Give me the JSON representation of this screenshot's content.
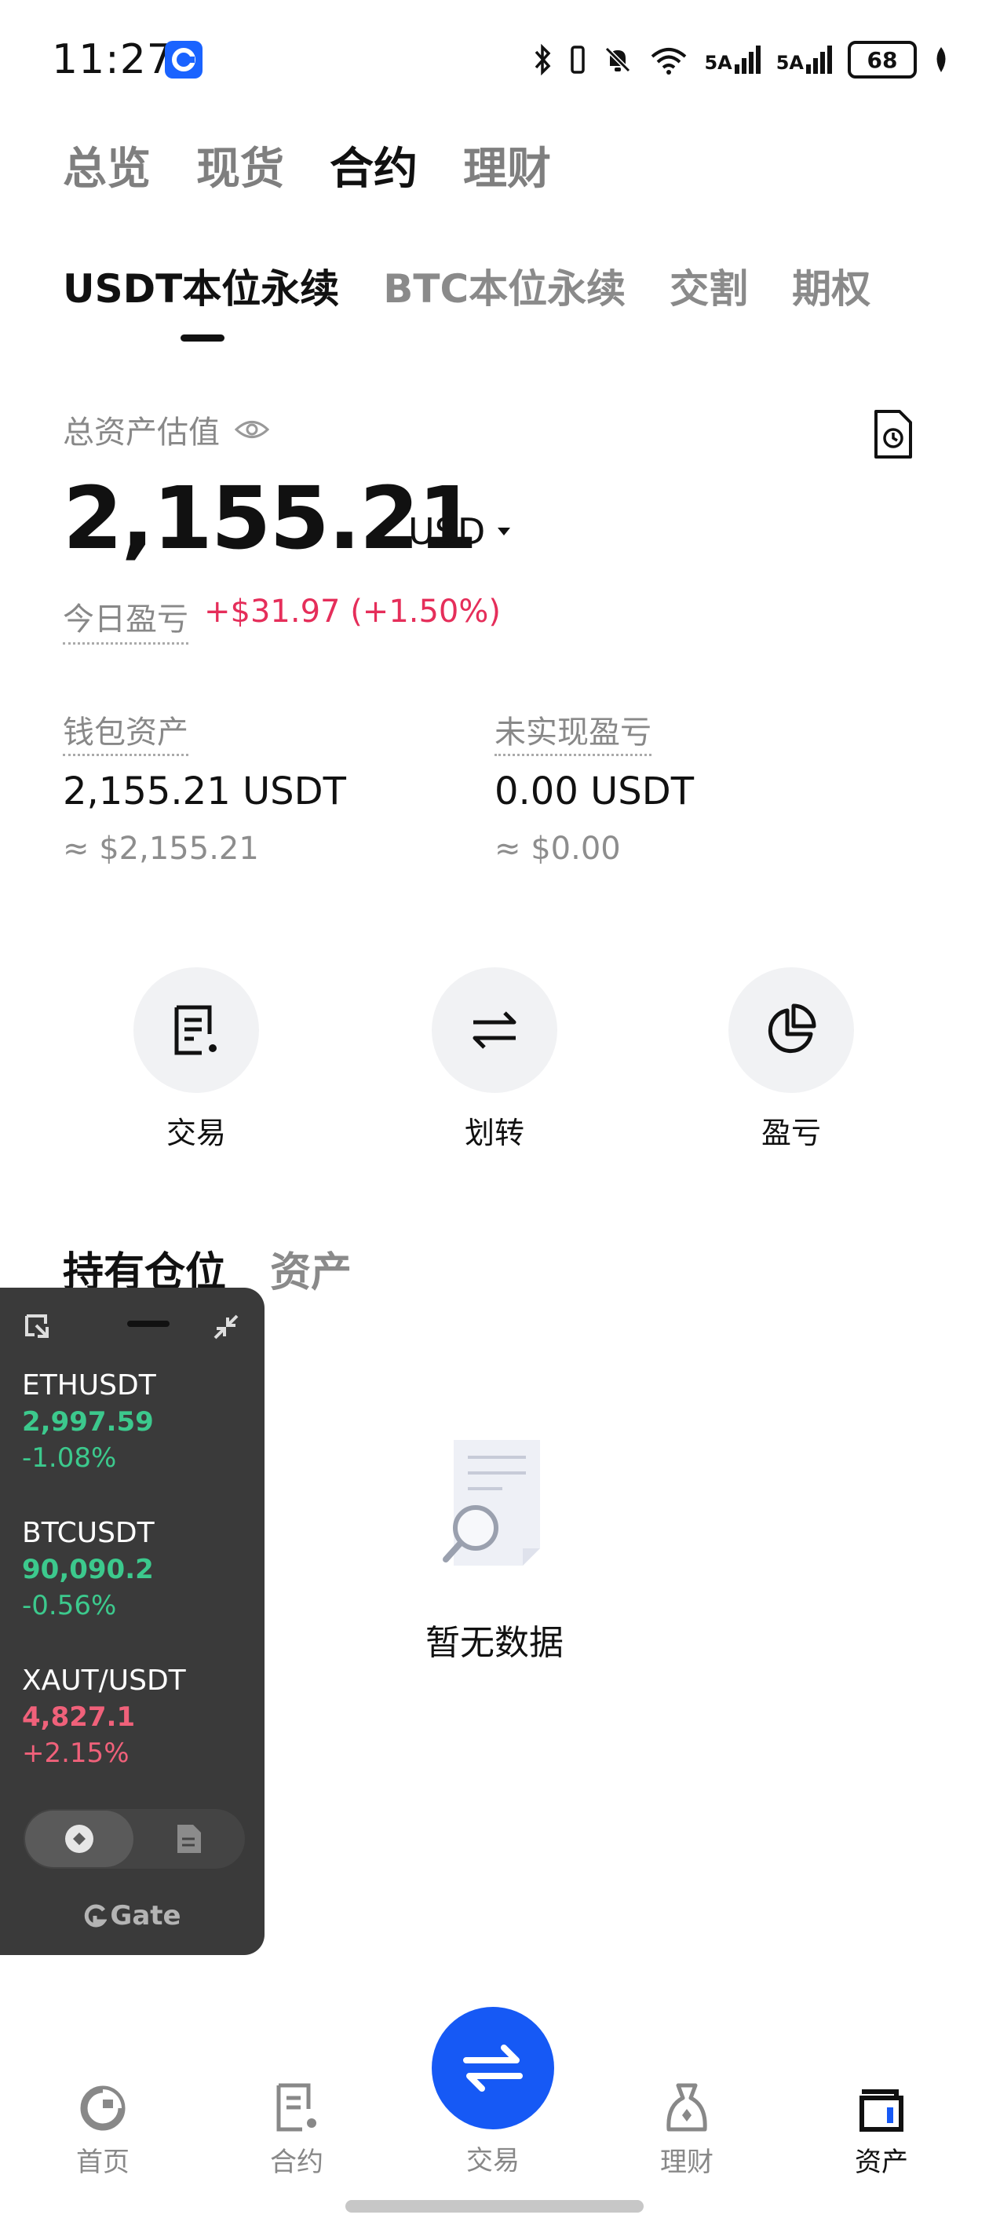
{
  "status_bar": {
    "time": "11:27",
    "net1": "5A",
    "net2": "5A",
    "battery": "68",
    "icons": [
      "bluetooth-icon",
      "vibrate-icon",
      "mute-icon",
      "wifi-icon",
      "signal-icon",
      "leaf-icon"
    ]
  },
  "top_tabs": [
    "总览",
    "现货",
    "合约",
    "理财"
  ],
  "sub_tabs": [
    "USDT本位永续",
    "BTC本位永续",
    "交割",
    "期权"
  ],
  "balance": {
    "label": "总资产估值",
    "amount": "2,155.21",
    "currency": "USD",
    "pnl_label": "今日盈亏",
    "pnl_value": "+$31.97 (+1.50%)"
  },
  "wallet": {
    "label": "钱包资产",
    "value": "2,155.21 USDT",
    "approx": "≈ $2,155.21"
  },
  "unrealized": {
    "label": "未实现盈亏",
    "value": "0.00 USDT",
    "approx": "≈ $0.00"
  },
  "actions": [
    "交易",
    "划转",
    "盈亏"
  ],
  "position_tabs": [
    "持有仓位",
    "资产"
  ],
  "empty_text": "暂无数据",
  "widget": {
    "tickers": [
      {
        "symbol": "ETHUSDT",
        "price": "2,997.59",
        "change": "-1.08%",
        "trend": "green"
      },
      {
        "symbol": "BTCUSDT",
        "price": "90,090.2",
        "change": "-0.56%",
        "trend": "green"
      },
      {
        "symbol": "XAUT/USDT",
        "price": "4,827.1",
        "change": "+2.15%",
        "trend": "red"
      }
    ],
    "brand": "Gate"
  },
  "bottom_nav": [
    "首页",
    "合约",
    "交易",
    "理财",
    "资产"
  ],
  "colors": {
    "accent": "#1659f5",
    "loss_red": "#e52e5a",
    "gain_green": "#3cc98d",
    "widget_bg": "#3a3a3a"
  }
}
